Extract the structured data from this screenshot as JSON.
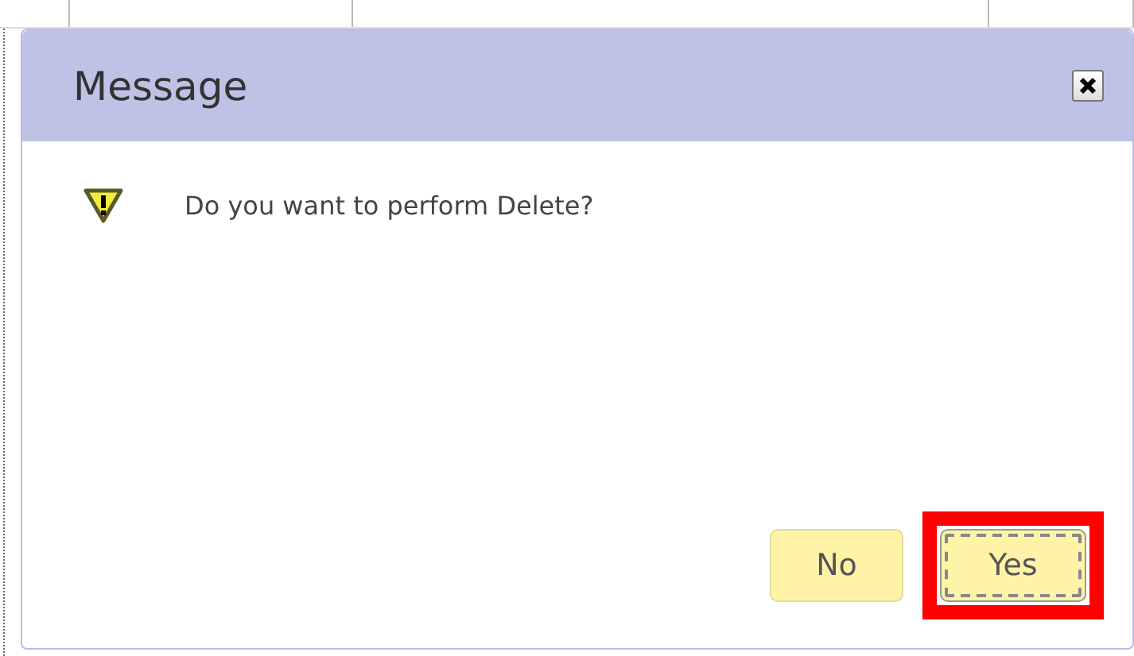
{
  "dialog": {
    "title": "Message",
    "message": "Do you want to perform Delete?",
    "buttons": [
      {
        "label": "No",
        "focused": false,
        "highlighted": false
      },
      {
        "label": "Yes",
        "focused": true,
        "highlighted": true
      }
    ]
  }
}
